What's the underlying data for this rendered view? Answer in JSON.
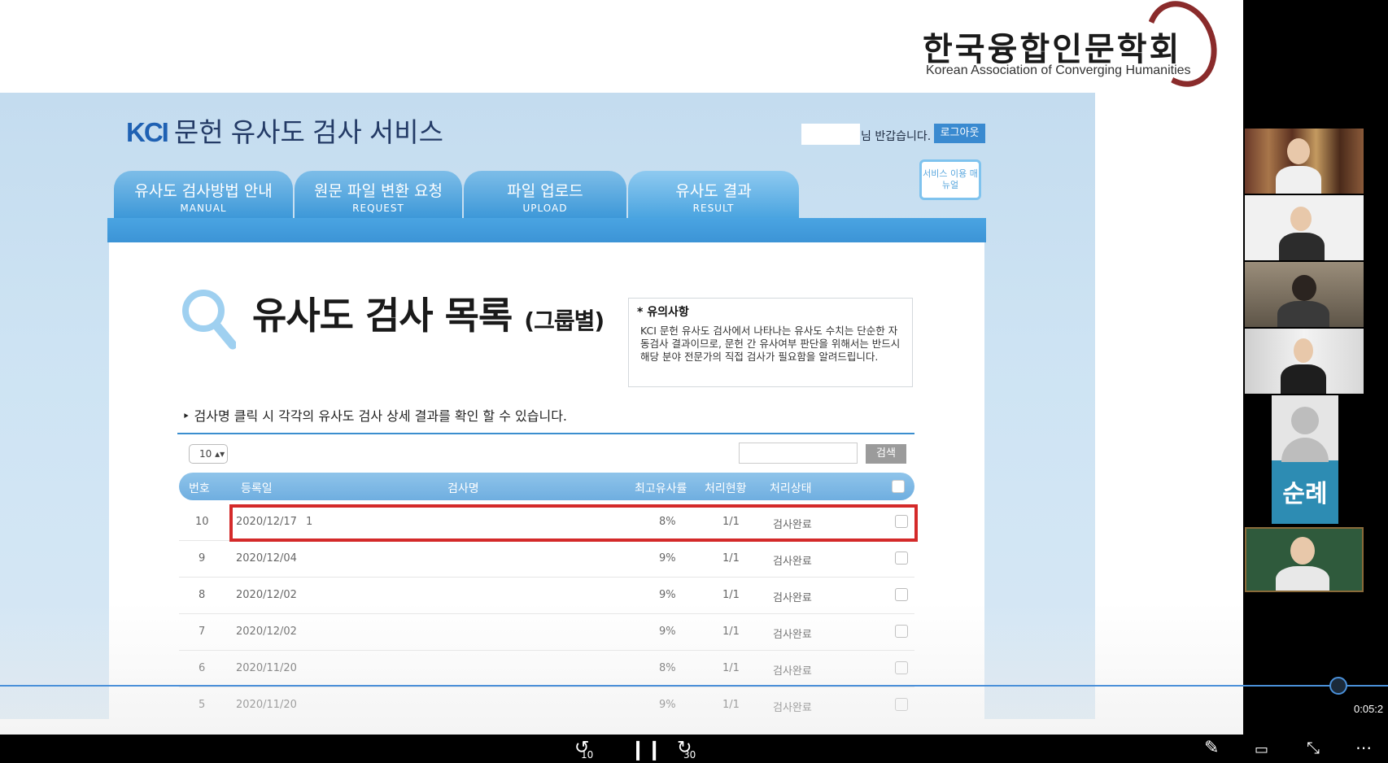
{
  "slide": {
    "assoc_name_ko": "한국융합인문학회",
    "assoc_name_en": "Korean Association of Converging Humanities"
  },
  "kci": {
    "brand": "KCI",
    "service_title": "문헌 유사도 검사 서비스",
    "welcome": "님 반갑습니다.",
    "logout": "로그아웃",
    "tabs": [
      {
        "ko": "유사도 검사방법 안내",
        "en": "MANUAL"
      },
      {
        "ko": "원문 파일 변환 요청",
        "en": "REQUEST"
      },
      {
        "ko": "파일 업로드",
        "en": "UPLOAD"
      },
      {
        "ko": "유사도 결과",
        "en": "RESULT"
      }
    ],
    "service_manual": "서비스 이용 매뉴얼",
    "list_title": "유사도 검사 목록",
    "list_title_sub": "(그룹별)",
    "notice_head": "* 유의사항",
    "notice_body": "KCI 문헌 유사도 검사에서 나타나는 유사도 수치는 단순한 자동검사 결과이므로, 문헌 간 유사여부 판단을 위해서는 반드시 해당 분야 전문가의 직접 검사가 필요함을 알려드립니다.",
    "hint": "‣ 검사명 클릭 시 각각의 유사도 검사 상세 결과를 확인 할 수 있습니다.",
    "page_size": "10 ▴▾",
    "search_button": "검색",
    "columns": [
      "번호",
      "등록일",
      "검사명",
      "최고유사률",
      "처리현황",
      "처리상태"
    ],
    "rows": [
      {
        "no": "10",
        "date": "2020/12/17",
        "name": "1",
        "rate": "8%",
        "progress": "1/1",
        "status": "검사완료"
      },
      {
        "no": "9",
        "date": "2020/12/04",
        "name": "",
        "rate": "9%",
        "progress": "1/1",
        "status": "검사완료"
      },
      {
        "no": "8",
        "date": "2020/12/02",
        "name": "",
        "rate": "9%",
        "progress": "1/1",
        "status": "검사완료"
      },
      {
        "no": "7",
        "date": "2020/12/02",
        "name": "",
        "rate": "9%",
        "progress": "1/1",
        "status": "검사완료"
      },
      {
        "no": "6",
        "date": "2020/11/20",
        "name": "",
        "rate": "8%",
        "progress": "1/1",
        "status": "검사완료"
      },
      {
        "no": "5",
        "date": "2020/11/20",
        "name": "",
        "rate": "9%",
        "progress": "1/1",
        "status": "검사완료"
      }
    ]
  },
  "player": {
    "time": "0:05:2",
    "skip_back": "10",
    "skip_forward": "30",
    "progress": 0.97
  },
  "participants": {
    "name_label": "순례"
  },
  "colors": {
    "highlight": "#d42a2a",
    "accent": "#4a90d9",
    "tab_blue": "#3d98d8"
  }
}
